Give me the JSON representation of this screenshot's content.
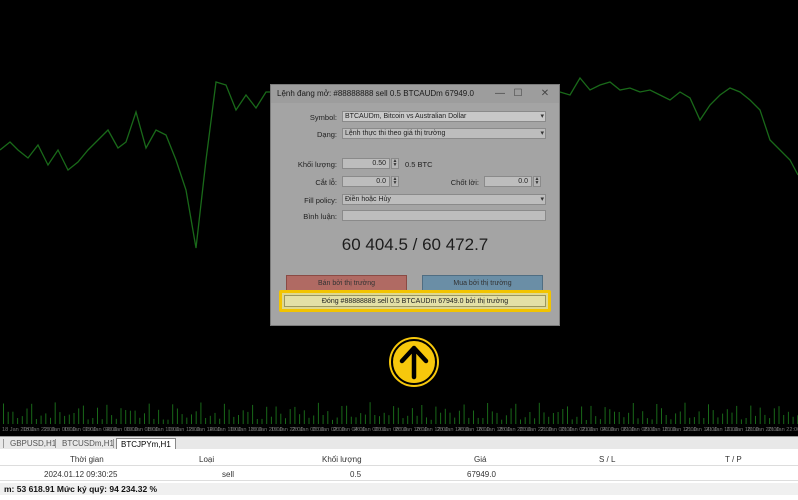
{
  "chart": {
    "line_color": "#2fbf2f",
    "time_labels": [
      "18 Jan 20:00",
      "18 Jan 22:00",
      "19 Jan 00:00",
      "19 Jan 02:00",
      "19 Jan 04:00",
      "19 Jan 06:00",
      "19 Jan 08:00",
      "19 Jan 10:00",
      "19 Jan 12:00",
      "19 Jan 14:00",
      "19 Jan 16:00",
      "19 Jan 18:00",
      "19 Jan 20:00",
      "19 Jan 22:00",
      "20 Jan 00:00",
      "20 Jan 02:00",
      "20 Jan 04:00",
      "20 Jan 06:00",
      "20 Jan 08:00",
      "20 Jan 10:00",
      "20 Jan 12:00",
      "20 Jan 14:00",
      "20 Jan 16:00",
      "20 Jan 18:00",
      "20 Jan 20:00",
      "20 Jan 22:00",
      "21 Jan 00:00",
      "21 Jan 02:00",
      "21 Jan 04:00",
      "21 Jan 06:00",
      "21 Jan 08:00",
      "21 Jan 10:00",
      "21 Jan 12:00",
      "21 Jan 14:00",
      "21 Jan 16:00",
      "21 Jan 18:00",
      "21 Jan 20:00",
      "21 Jan 22:00"
    ]
  },
  "tabs": [
    {
      "label": "GBPUSD,H1",
      "active": false
    },
    {
      "label": "BTCUSDm,H1",
      "active": false
    },
    {
      "label": "BTCJPYm,H1",
      "active": true
    }
  ],
  "terminal": {
    "headers": {
      "time": "Thời gian",
      "type": "Loại",
      "volume": "Khối lượng",
      "price": "Giá",
      "sl": "S / L",
      "tp": "T / P"
    },
    "row": {
      "time": "2024.01.12 09:30:25",
      "type": "sell",
      "volume": "0.5",
      "price": "67949.0"
    },
    "balance": "m: 53 618.91  Mức ký quỹ: 94 234.32 %"
  },
  "dialog": {
    "title": "Lệnh đang mở: #88888888  sell 0.5 BTCAUDm 67949.0",
    "minimize": "—",
    "maximize": "☐",
    "close": "✕",
    "symbol_label": "Symbol:",
    "symbol_value": "BTCAUDm, Bitcoin vs Australian Dollar",
    "type_label": "Dạng:",
    "type_value": "Lệnh thực thi theo giá thị trường",
    "volume_label": "Khối lượng:",
    "volume_value": "0.50",
    "volume_unit": "0.5 BTC",
    "sl_label": "Cắt lỗ:",
    "sl_value": "0.0",
    "tp_label": "Chốt lời:",
    "tp_value": "0.0",
    "fill_label": "Fill policy:",
    "fill_value": "Điền hoặc Hủy",
    "comment_label": "Bình luận:",
    "comment_value": "",
    "prices": "60 404.5 / 60 472.7",
    "sell_button": "Bán bởi thị trường",
    "buy_button": "Mua bởi thị trường",
    "close_position_button": "Đóng  #88888888  sell 0.5 BTCAUDm 67949.0 bởi thị trường"
  },
  "overlay": {
    "arrow_color": "#f7c80c",
    "highlight_color": "#f2c400"
  }
}
